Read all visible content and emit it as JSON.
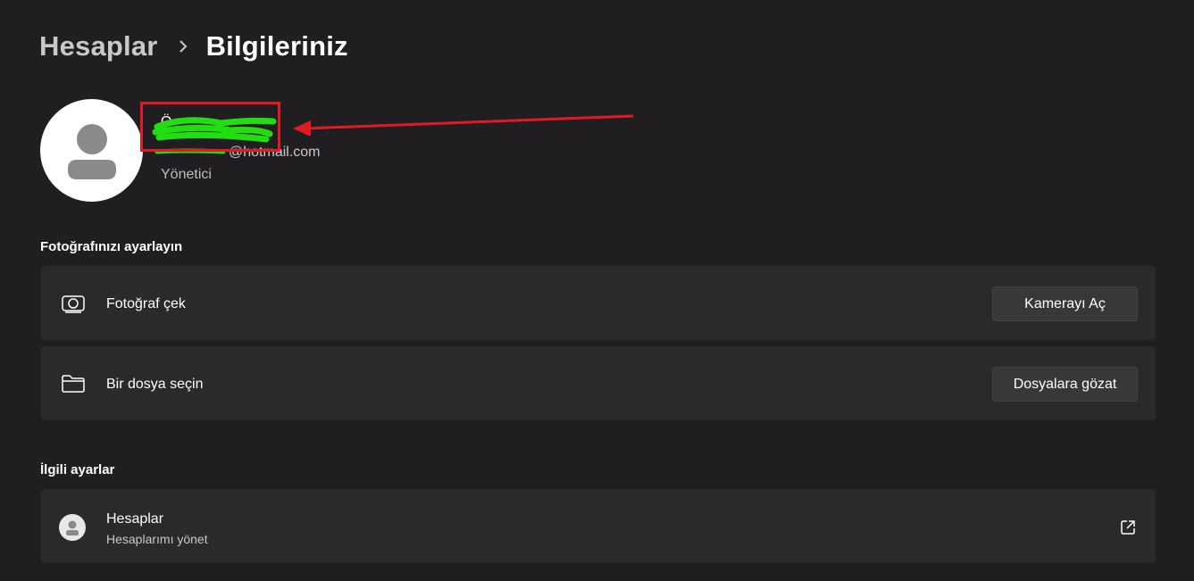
{
  "breadcrumb": {
    "parent": "Hesaplar",
    "current": "Bilgileriniz"
  },
  "profile": {
    "name": "Ö",
    "email": "@hotmail.com",
    "role": "Yönetici"
  },
  "photo_section": {
    "title": "Fotoğrafınızı ayarlayın",
    "items": [
      {
        "icon": "camera-icon",
        "label": "Fotoğraf çek",
        "button": "Kamerayı Aç"
      },
      {
        "icon": "folder-icon",
        "label": "Bir dosya seçin",
        "button": "Dosyalara gözat"
      }
    ]
  },
  "related_section": {
    "title": "İlgili ayarlar",
    "items": [
      {
        "icon": "account-icon",
        "label": "Hesaplar",
        "sublabel": "Hesaplarımı yönet",
        "action_icon": "external-link-icon"
      }
    ]
  },
  "colors": {
    "background": "#211e21",
    "card": "#2c292c",
    "annotation_red": "#e01b24",
    "redaction_green": "#22dd11"
  }
}
